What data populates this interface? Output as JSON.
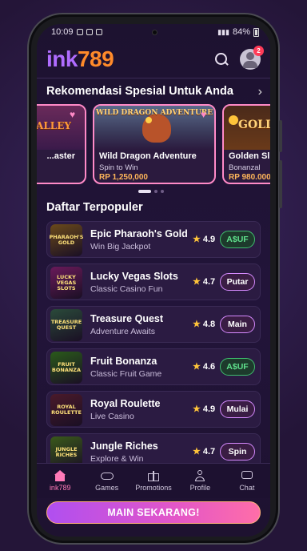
{
  "status_bar": {
    "time": "10:09",
    "battery": "84%"
  },
  "header": {
    "logo_ink": "ink",
    "logo_num": "789",
    "notification_count": "2"
  },
  "recommendations": {
    "title": "Rekomendasi Spesial Untuk Anda",
    "cards": [
      {
        "name": "...aster",
        "art_text": "ALLEY"
      },
      {
        "name": "Wild Dragon Adventure",
        "subtitle": "Spin to Win",
        "price": "RP 1,250,000",
        "art_text": "WILD DRAGON ADVENTURE"
      },
      {
        "name": "Golden Sl...",
        "subtitle": "Bonanzal",
        "price": "RP 980.000",
        "art_text": "GOLD"
      }
    ]
  },
  "popular": {
    "title": "Daftar Terpopuler",
    "items": [
      {
        "name": "Epic Pharaoh's Gold",
        "desc": "Win Big Jackpot",
        "rating": "4.9",
        "action": "A$UF",
        "style": "green",
        "thumb": "PHARAOH'S GOLD",
        "thumb_color": "#6a4a1a"
      },
      {
        "name": "Lucky Vegas Slots",
        "desc": "Classic Casino Fun",
        "rating": "4.7",
        "action": "Putar",
        "style": "pink",
        "thumb": "LUCKY VEGAS SLOTS",
        "thumb_color": "#6a1a5a"
      },
      {
        "name": "Treasure Quest",
        "desc": "Adventure Awaits",
        "rating": "4.8",
        "action": "Main",
        "style": "pink",
        "thumb": "TREASURE QUEST",
        "thumb_color": "#2a4a3a"
      },
      {
        "name": "Fruit Bonanza",
        "desc": "Classic Fruit Game",
        "rating": "4.6",
        "action": "A$UF",
        "style": "green",
        "thumb": "FRUIT BONANZA",
        "thumb_color": "#2a5a1a"
      },
      {
        "name": "Royal Roulette",
        "desc": "Live Casino",
        "rating": "4.9",
        "action": "Mulai",
        "style": "pink",
        "thumb": "ROYAL ROULETTE",
        "thumb_color": "#4a1a2a"
      },
      {
        "name": "Jungle Riches",
        "desc": "Explore & Win",
        "rating": "4.7",
        "action": "Spin",
        "style": "pink",
        "thumb": "JUNGLE RICHES",
        "thumb_color": "#3a5a1a"
      }
    ]
  },
  "bottom_nav": [
    {
      "label": "ink789",
      "icon": "home-icon"
    },
    {
      "label": "Games",
      "icon": "gamepad-icon"
    },
    {
      "label": "Promotions",
      "icon": "gift-icon"
    },
    {
      "label": "Profile",
      "icon": "user-icon"
    },
    {
      "label": "Chat",
      "icon": "chat-icon"
    }
  ],
  "cta": {
    "label": "MAIN SEKARANG!"
  }
}
